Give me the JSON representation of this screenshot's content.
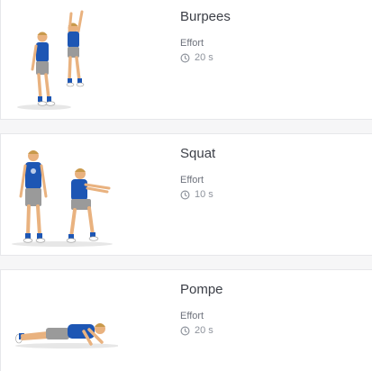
{
  "exercises": [
    {
      "name": "Burpees",
      "effort_label": "Effort",
      "duration": "20 s",
      "icon": "clock-icon"
    },
    {
      "name": "Squat",
      "effort_label": "Effort",
      "duration": "10 s",
      "icon": "clock-icon"
    },
    {
      "name": "Pompe",
      "effort_label": "Effort",
      "duration": "20 s",
      "icon": "clock-icon"
    }
  ],
  "colors": {
    "shirt": "#1d56b4",
    "shorts": "#9a9a9a",
    "skin": "#e9b27f",
    "hair": "#c89a4c",
    "text": "#3c3f47",
    "muted": "#8e939c"
  }
}
